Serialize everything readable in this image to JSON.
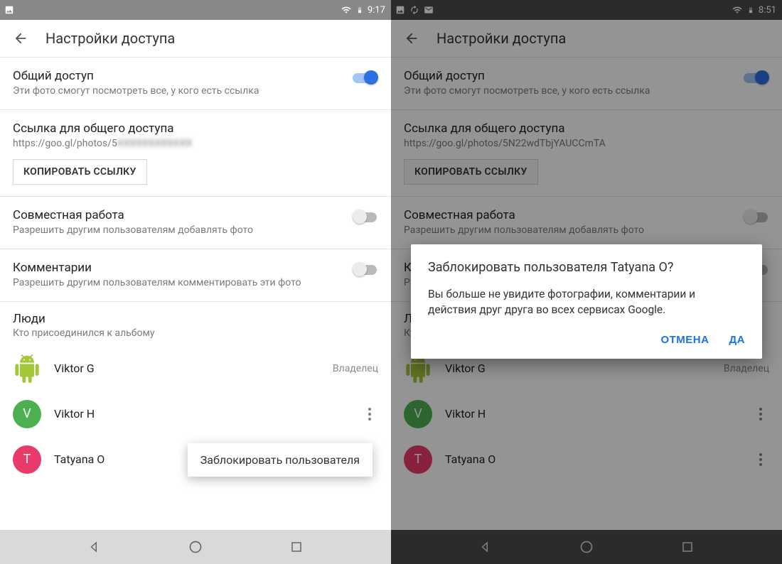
{
  "left": {
    "status_time": "9:17",
    "appbar_title": "Настройки доступа",
    "sharing": {
      "title": "Общий доступ",
      "subtitle": "Эти фото смогут посмотреть все, у кого есть ссылка",
      "on": true
    },
    "link": {
      "title": "Ссылка для общего доступа",
      "url_prefix": "https://goo.gl/photos/5",
      "copy_label": "КОПИРОВАТЬ ССЫЛКУ"
    },
    "collab": {
      "title": "Совместная работа",
      "subtitle": "Разрешить другим пользователям добавлять фото",
      "on": false
    },
    "comments": {
      "title": "Комментарии",
      "subtitle": "Разрешить другим пользователям комментировать эти фото",
      "on": false
    },
    "people": {
      "title": "Люди",
      "subtitle": "Кто присоединился к альбому",
      "owner_label": "Владелец",
      "items": [
        {
          "name": "Viktor G"
        },
        {
          "name": "Viktor H",
          "initial": "V"
        },
        {
          "name": "Tatyana O",
          "initial": "T"
        }
      ],
      "popup_label": "Заблокировать пользователя"
    }
  },
  "right": {
    "status_time": "8:51",
    "appbar_title": "Настройки доступа",
    "sharing": {
      "title": "Общий доступ",
      "subtitle": "Эти фото смогут посмотреть все, у кого есть ссылка",
      "on": true
    },
    "link": {
      "title": "Ссылка для общего доступа",
      "url": "https://goo.gl/photos/5N22wdTbjYAUCCmTA",
      "copy_label": "КОПИРОВАТЬ ССЫЛКУ"
    },
    "collab": {
      "title": "Совместная работа",
      "subtitle": "Разрешить другим пользователям добавлять фото",
      "on": false
    },
    "comments": {
      "title": "Комментарии",
      "subtitle": "Разрешить другим пользователям комментировать эти фото",
      "on": false
    },
    "people": {
      "title": "Люди",
      "subtitle": "Кто присоединился к альбому",
      "owner_label": "Владелец",
      "items": [
        {
          "name": "Viktor G"
        },
        {
          "name": "Viktor H",
          "initial": "V"
        },
        {
          "name": "Tatyana O",
          "initial": "T"
        }
      ]
    },
    "dialog": {
      "title": "Заблокировать пользователя Tatyana O?",
      "body": "Вы больше не увидите фотографии, комментарии и действия друг друга во всех сервисах Google.",
      "cancel": "ОТМЕНА",
      "confirm": "ДА"
    }
  }
}
